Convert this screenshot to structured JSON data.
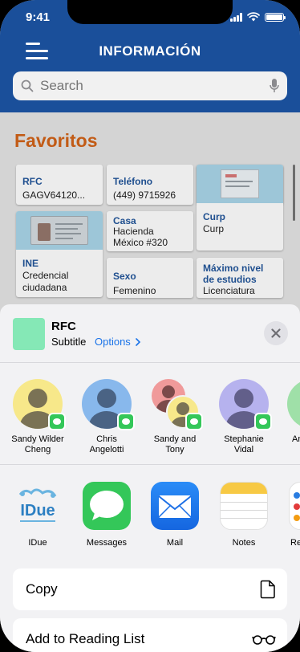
{
  "status_bar": {
    "time": "9:41"
  },
  "header": {
    "title": "INFORMACIÓN"
  },
  "search": {
    "placeholder": "Search"
  },
  "favorites": {
    "title": "Favoritos",
    "tiles": [
      {
        "label": "RFC",
        "value": "GAGV64120..."
      },
      {
        "label": "Teléfono",
        "value": "(449) 9715926"
      },
      {
        "label": "Curp",
        "value": "Curp"
      },
      {
        "label": "Casa",
        "value_line1": "Hacienda",
        "value_line2": "México #320"
      },
      {
        "label": "INE",
        "value_line1": "Credencial",
        "value_line2": "ciudadana"
      },
      {
        "label": "Sexo",
        "value": "Femenino"
      },
      {
        "label_line1": "Máximo nivel",
        "label_line2": "de estudios",
        "value": "Licenciatura"
      }
    ]
  },
  "share_sheet": {
    "title": "RFC",
    "subtitle": "Subtitle",
    "options_label": "Options",
    "close_icon": "close-icon",
    "people": [
      {
        "name_line1": "Sandy Wilder",
        "name_line2": "Cheng",
        "color": "#f7e88a"
      },
      {
        "name_line1": "Chris",
        "name_line2": "Angelotti",
        "color": "#88b8ec"
      },
      {
        "name_line1": "Sandy and",
        "name_line2": "Tony",
        "color": "#f09a9a"
      },
      {
        "name_line1": "Stephanie",
        "name_line2": "Vidal",
        "color": "#b6b2ee"
      },
      {
        "name_line1": "An",
        "name_line2": ""
      }
    ],
    "apps": [
      {
        "name": "IDue"
      },
      {
        "name": "Messages"
      },
      {
        "name": "Mail"
      },
      {
        "name": "Notes"
      },
      {
        "name": "Re"
      }
    ],
    "actions": [
      {
        "label": "Copy",
        "icon": "document-icon"
      },
      {
        "label": "Add to Reading List",
        "icon": "glasses-icon"
      }
    ]
  },
  "colors": {
    "header_blue": "#1a4f9a",
    "section_orange": "#c25b16",
    "link_blue": "#1a73e8",
    "messages_green": "#34c759"
  }
}
